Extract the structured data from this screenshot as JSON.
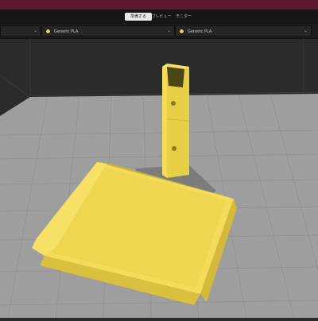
{
  "nav": {
    "tabs": [
      {
        "label": "準備する",
        "active": true
      },
      {
        "label": "プレビュー",
        "active": false
      },
      {
        "label": "モニター",
        "active": false
      }
    ]
  },
  "extruders": [
    {
      "material": "Generic PLA",
      "color": "#f2d84b"
    },
    {
      "material": "Generic PLA",
      "color": "#f2d84b"
    }
  ],
  "colors": {
    "titlebar": "#5a1a2c",
    "model": "#f2d84b",
    "build_plate": "#9a9a9a",
    "background": "#2b2b2b"
  }
}
